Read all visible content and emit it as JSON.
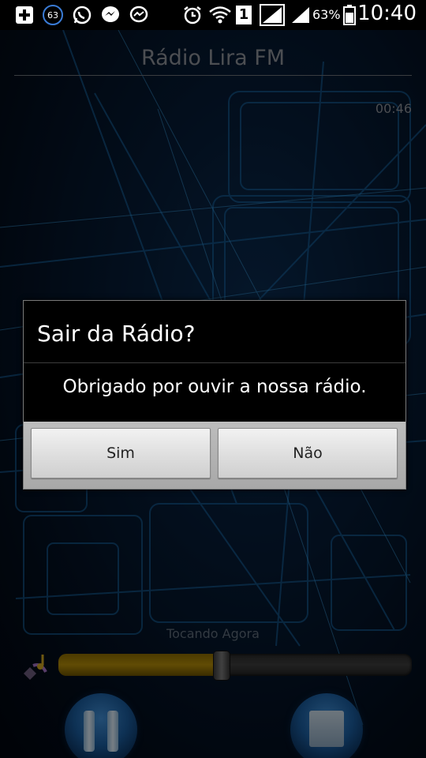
{
  "status_bar": {
    "notification_count": "63",
    "battery_percent": "63%",
    "time": "10:40",
    "sim_slot": "1"
  },
  "app": {
    "title": "Rádio Lira FM",
    "elapsed": "00:46",
    "now_playing_label": "Tocando Agora",
    "volume_level": 0.46
  },
  "dialog": {
    "title": "Sair da Rádio?",
    "message": "Obrigado por ouvir a nossa rádio.",
    "yes_label": "Sim",
    "no_label": "Não"
  },
  "colors": {
    "accent_blue": "#1a5a9a",
    "volume_fill": "#b08a0a"
  }
}
